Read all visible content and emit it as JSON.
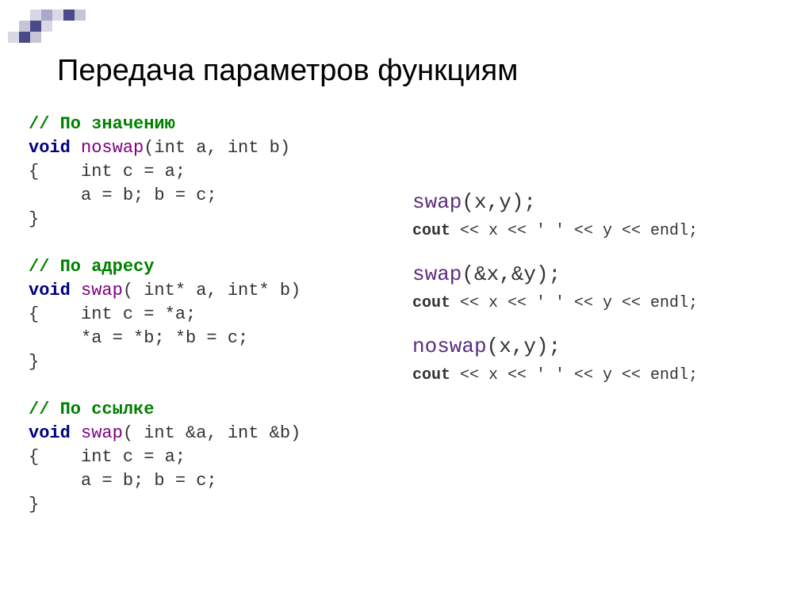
{
  "title": "Передача параметров функциям",
  "left": {
    "block1": {
      "comment": "// По значению",
      "sig_void": "void",
      "sig_name": " noswap",
      "sig_params": "(int a, int b)",
      "line_open": "{    int c = a;",
      "line_body": "     a = b; b = c;",
      "line_close": "}"
    },
    "block2": {
      "comment": "// По адресу",
      "sig_void": "void",
      "sig_name": " swap",
      "sig_params": "( int* a, int* b)",
      "line_open": "{    int c = *a;",
      "line_body": "     *a = *b; *b = c;",
      "line_close": "}"
    },
    "block3": {
      "comment": "// По ссылке",
      "sig_void": "void",
      "sig_name": " swap",
      "sig_params": "( int &a, int &b)",
      "line_open": "{    int c = a;",
      "line_body": "     a = b; b = c;",
      "line_close": "}"
    }
  },
  "right": {
    "call1_fn": "swap",
    "call1_args": "(x,y);",
    "cout1": "cout << x << ' ' << y << endl;",
    "call2_fn": "swap",
    "call2_args": "(&x,&y);",
    "cout2": "cout << x << ' ' << y << endl;",
    "call3_fn": "noswap",
    "call3_args": "(x,y);",
    "cout3": "cout << x << ' ' << y << endl;"
  }
}
